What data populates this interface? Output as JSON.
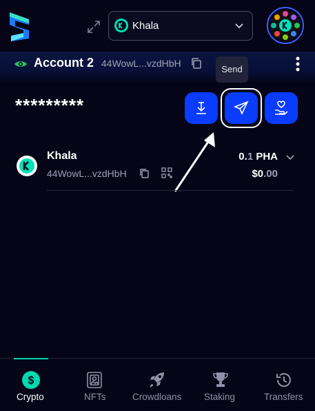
{
  "header": {
    "network": {
      "name": "Khala",
      "icon": "khala-network-icon"
    },
    "expand_icon": "expand-icon",
    "avatar_icon": "account-avatar-icon"
  },
  "account": {
    "name": "Account 2",
    "address": "44WowL...vzdHbH"
  },
  "tooltip": {
    "label": "Send"
  },
  "balance": {
    "masked": "*********"
  },
  "actions": {
    "receive_icon": "receive-icon",
    "send_icon": "send-icon",
    "donate_icon": "donate-icon"
  },
  "tokens": [
    {
      "name": "Khala",
      "address": "44WowL...vzdHbH",
      "amount_int": "0.",
      "amount_dec": "1",
      "symbol": "PHA",
      "value_int": "$0",
      "value_dec": ".00"
    }
  ],
  "tabs": [
    {
      "label": "Crypto",
      "icon": "dollar-coin-icon",
      "active": true
    },
    {
      "label": "NFTs",
      "icon": "nft-icon",
      "active": false
    },
    {
      "label": "Crowdloans",
      "icon": "rocket-icon",
      "active": false
    },
    {
      "label": "Staking",
      "icon": "trophy-icon",
      "active": false
    },
    {
      "label": "Transfers",
      "icon": "clock-history-icon",
      "active": false
    }
  ],
  "colors": {
    "accent": "#0a3cff",
    "teal": "#00d9b0",
    "background": "#050517"
  }
}
